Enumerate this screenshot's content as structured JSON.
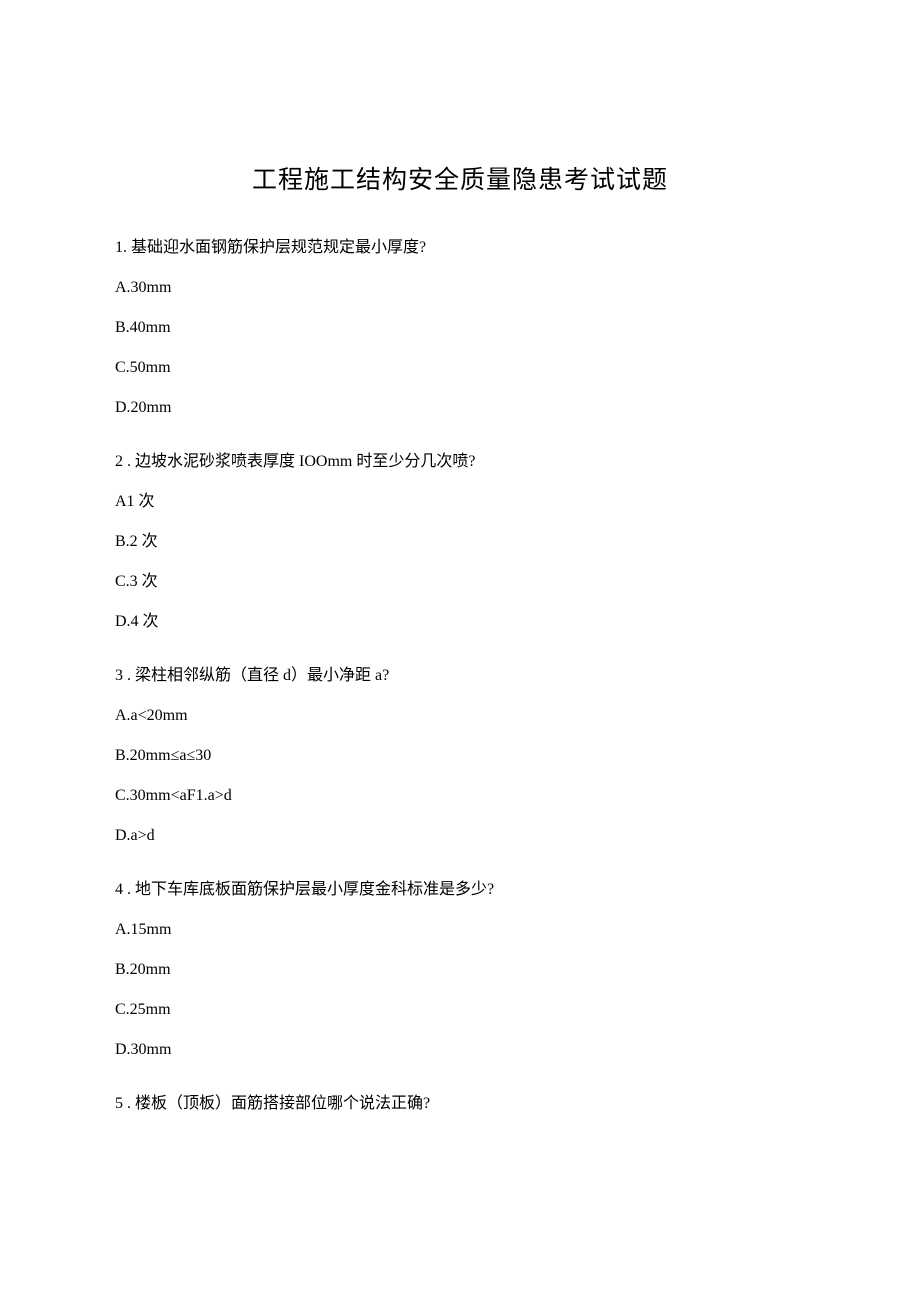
{
  "title": "工程施工结构安全质量隐患考试试题",
  "questions": [
    {
      "num": "1.",
      "text": "基础迎水面钢筋保护层规范规定最小厚度?",
      "options": [
        "A.30mm",
        "B.40mm",
        "C.50mm",
        "D.20mm"
      ]
    },
    {
      "num": "2 .",
      "text": "边坡水泥砂浆喷表厚度 IOOmm 时至少分几次喷?",
      "options": [
        "A1 次",
        "B.2 次",
        "C.3 次",
        "D.4 次"
      ]
    },
    {
      "num": "3 .",
      "text": "梁柱相邻纵筋（直径 d）最小净距 a?",
      "options": [
        "A.a<20mm",
        "B.20mm≤a≤30",
        "C.30mm<aF1.a>d",
        "D.a>d"
      ]
    },
    {
      "num": "4 .",
      "text": "地下车库底板面筋保护层最小厚度金科标准是多少?",
      "options": [
        "A.15mm",
        "B.20mm",
        "C.25mm",
        "D.30mm"
      ]
    },
    {
      "num": "5 .",
      "text": "楼板（顶板）面筋搭接部位哪个说法正确?",
      "options": []
    }
  ]
}
